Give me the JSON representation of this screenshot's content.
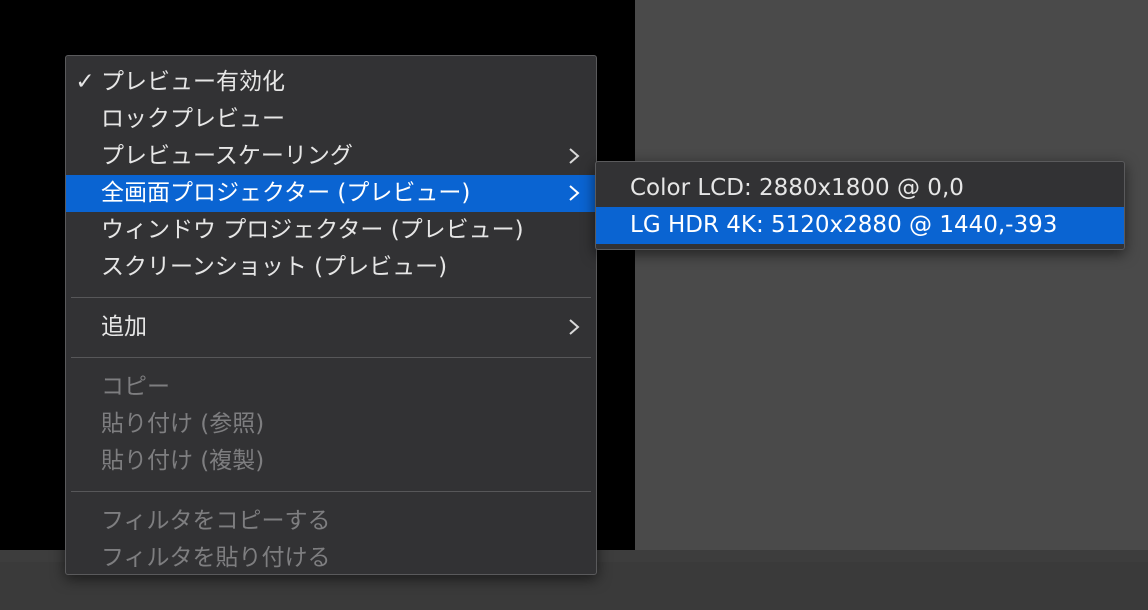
{
  "colors": {
    "menu_bg": "#323234",
    "highlight": "#0a64d2",
    "preview_bg": "#000000",
    "workspace_bg": "#4a4a4a",
    "disabled_text": "#7e7e80"
  },
  "context_menu": {
    "check_mark": "✓",
    "items": [
      {
        "label": "プレビュー有効化",
        "checked": true
      },
      {
        "label": "ロックプレビュー"
      },
      {
        "label": "プレビュースケーリング",
        "has_submenu": true
      },
      {
        "label": "全画面プロジェクター (プレビュー)",
        "has_submenu": true,
        "highlighted": true
      },
      {
        "label": "ウィンドウ プロジェクター (プレビュー)"
      },
      {
        "label": "スクリーンショット (プレビュー)"
      },
      {
        "label": "追加",
        "has_submenu": true
      },
      {
        "label": "コピー",
        "disabled": true
      },
      {
        "label": "貼り付け (参照)",
        "disabled": true
      },
      {
        "label": "貼り付け (複製)",
        "disabled": true
      },
      {
        "label": "フィルタをコピーする",
        "disabled": true
      },
      {
        "label": "フィルタを貼り付ける",
        "disabled": true
      }
    ]
  },
  "projector_submenu": {
    "items": [
      {
        "label": "Color LCD: 2880x1800 @ 0,0"
      },
      {
        "label": "LG HDR 4K: 5120x2880 @ 1440,-393",
        "highlighted": true
      }
    ]
  },
  "icons": {
    "submenu_arrow": "chevron-right-icon",
    "check": "checkmark-icon"
  }
}
